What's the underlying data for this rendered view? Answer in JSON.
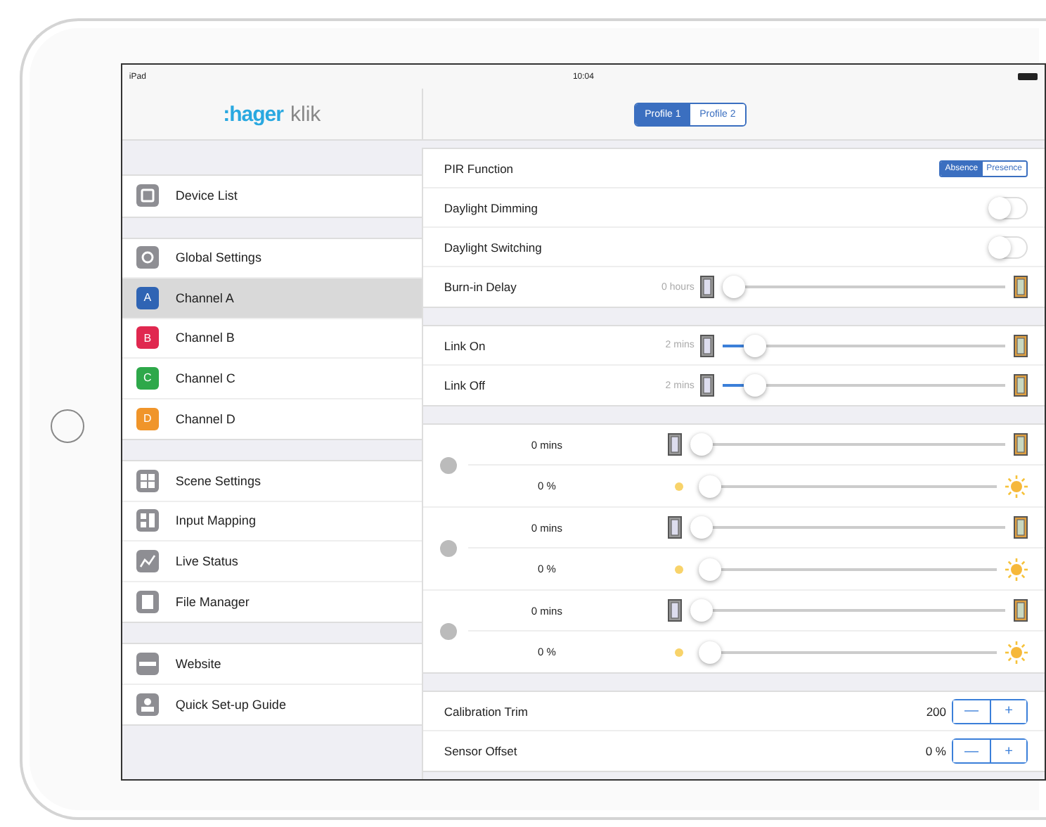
{
  "status_bar": {
    "carrier": "iPad",
    "time": "10:04"
  },
  "logo": {
    "brand": ":hager",
    "product": "klik"
  },
  "profiles": [
    {
      "label": "Profile 1",
      "selected": true
    },
    {
      "label": "Profile 2",
      "selected": false
    }
  ],
  "sidebar": {
    "groups": [
      {
        "items": [
          {
            "label": "Device List",
            "kind": "device",
            "selected": false
          }
        ]
      },
      {
        "items": [
          {
            "label": "Global Settings",
            "kind": "gear",
            "selected": false
          },
          {
            "label": "Channel A",
            "kind": "channel",
            "letter": "A",
            "color": "#2f64b4",
            "selected": true
          },
          {
            "label": "Channel B",
            "kind": "channel",
            "letter": "B",
            "color": "#e0284f",
            "selected": false
          },
          {
            "label": "Channel C",
            "kind": "channel",
            "letter": "C",
            "color": "#2ea84a",
            "selected": false
          },
          {
            "label": "Channel D",
            "kind": "channel",
            "letter": "D",
            "color": "#f0952a",
            "selected": false
          }
        ]
      },
      {
        "items": [
          {
            "label": "Scene Settings",
            "kind": "grid",
            "selected": false
          },
          {
            "label": "Input Mapping",
            "kind": "mapping",
            "selected": false
          },
          {
            "label": "Live Status",
            "kind": "chart",
            "selected": false
          },
          {
            "label": "File Manager",
            "kind": "file",
            "selected": false
          }
        ]
      },
      {
        "items": [
          {
            "label": "Website",
            "kind": "web",
            "selected": false
          },
          {
            "label": "Quick Set-up Guide",
            "kind": "person",
            "selected": false
          }
        ]
      }
    ]
  },
  "sections": [
    {
      "rows": [
        {
          "kind": "segment",
          "label": "PIR Function",
          "options": [
            {
              "label": "Absence",
              "selected": true
            },
            {
              "label": "Presence",
              "selected": false
            }
          ]
        },
        {
          "kind": "toggle",
          "label": "Daylight Dimming",
          "on": false
        },
        {
          "kind": "toggle",
          "label": "Daylight Switching",
          "on": false
        },
        {
          "kind": "slider",
          "label": "Burn-in Delay",
          "reading": "0 hours",
          "level": 0
        }
      ]
    },
    {
      "rows": [
        {
          "kind": "slider",
          "label": "Link On",
          "reading": "2 mins",
          "level": 0.08
        },
        {
          "kind": "slider",
          "label": "Link Off",
          "reading": "2 mins",
          "level": 0.08
        }
      ]
    },
    {
      "rows": [
        {
          "kind": "scene",
          "rows": [
            {
              "reading": "0 mins",
              "kind": "time",
              "level": 0
            },
            {
              "reading": "0 %",
              "kind": "light",
              "level": 0
            }
          ]
        },
        {
          "kind": "scene",
          "rows": [
            {
              "reading": "0 mins",
              "kind": "time",
              "level": 0
            },
            {
              "reading": "0 %",
              "kind": "light",
              "level": 0
            }
          ]
        },
        {
          "kind": "scene",
          "rows": [
            {
              "reading": "0 mins",
              "kind": "time",
              "level": 0
            },
            {
              "reading": "0 %",
              "kind": "light",
              "level": 0
            }
          ]
        }
      ]
    },
    {
      "rows": [
        {
          "kind": "stepper",
          "label": "Calibration Trim",
          "value": "200",
          "minus": "—",
          "plus": "+"
        },
        {
          "kind": "stepper",
          "label": "Sensor Offset",
          "value": "0 %",
          "minus": "—",
          "plus": "+"
        }
      ]
    }
  ]
}
